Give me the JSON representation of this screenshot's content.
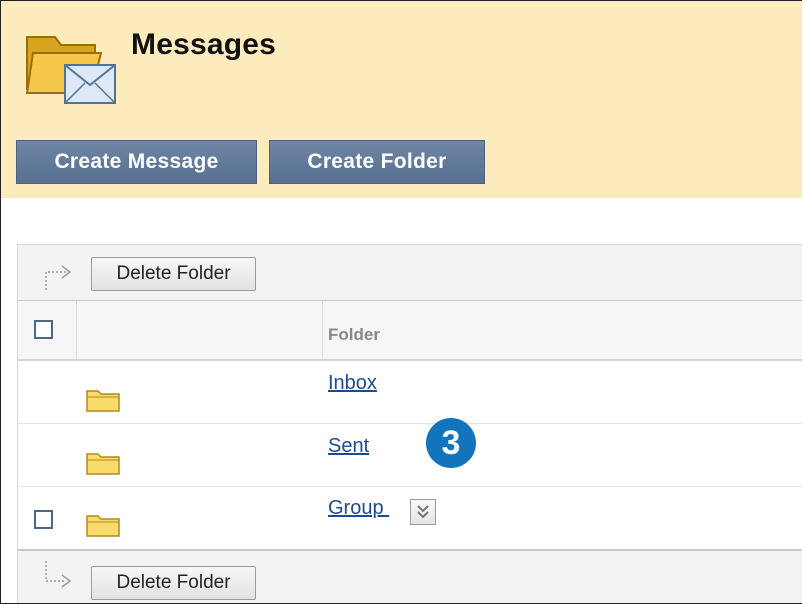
{
  "page": {
    "title": "Messages"
  },
  "actions": {
    "create_message": "Create Message",
    "create_folder": "Create Folder"
  },
  "toolbar": {
    "delete_folder": "Delete Folder"
  },
  "table": {
    "column_folder": "Folder",
    "rows": [
      {
        "name": "Inbox",
        "has_checkbox": false,
        "has_menu": false
      },
      {
        "name": "Sent",
        "has_checkbox": false,
        "has_menu": false
      },
      {
        "name": "Group ",
        "has_checkbox": true,
        "has_menu": true
      }
    ]
  },
  "callout": {
    "step": "3"
  },
  "colors": {
    "header_bg": "#fbebbd",
    "action_button_bg": "#5e7896",
    "link": "#1d4b8d",
    "callout_bg": "#1174bc"
  }
}
